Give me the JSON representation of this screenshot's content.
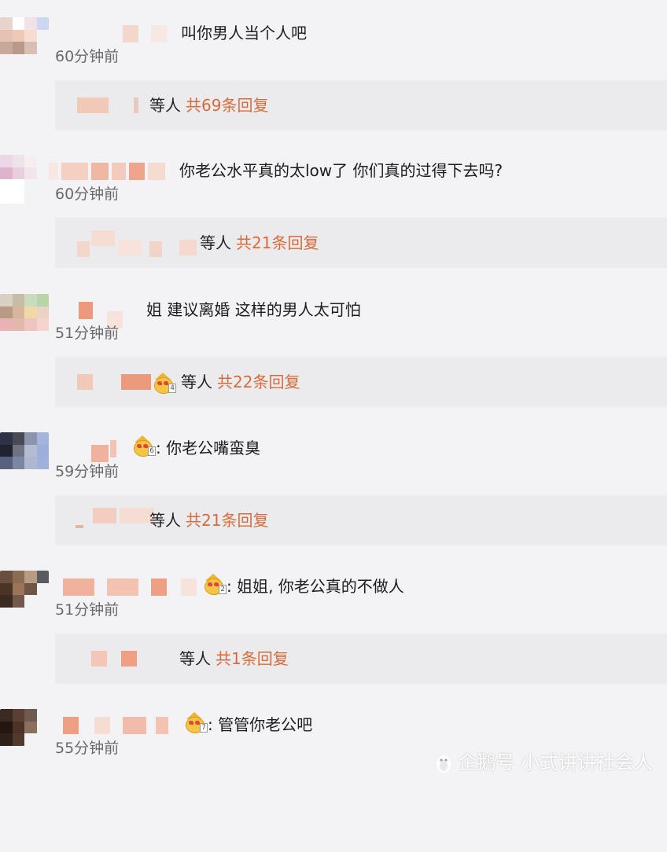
{
  "colors": {
    "background": "#f3f3f5",
    "reply_box": "#ebebed",
    "reply_count": "#d96b3b",
    "time_text": "#6a6a6a"
  },
  "comments": [
    {
      "text": "叫你男人当个人吧",
      "time": "60分钟前",
      "reply_prefix": "等人",
      "reply_count": "共69条回复",
      "badge_level": ""
    },
    {
      "text": "你老公水平真的太low了 你们真的过得下去吗?",
      "time": "60分钟前",
      "reply_prefix": "等人",
      "reply_count": "共21条回复",
      "badge_level": ""
    },
    {
      "text": "姐 建议离婚 这样的男人太可怕",
      "time": "51分钟前",
      "reply_prefix": "等人",
      "reply_count": "共22条回复",
      "badge_level": "4"
    },
    {
      "text": ": 你老公嘴蛮臭",
      "time": "59分钟前",
      "reply_prefix": "等人",
      "reply_count": "共21条回复",
      "badge_level": "6"
    },
    {
      "text": ": 姐姐, 你老公真的不做人",
      "time": "51分钟前",
      "reply_prefix": "等人",
      "reply_count": "共1条回复",
      "badge_level": "2"
    },
    {
      "text": ": 管管你老公吧",
      "time": "55分钟前",
      "reply_prefix": "",
      "reply_count": "",
      "badge_level": "7"
    }
  ],
  "watermark": {
    "icon": "penguin-icon",
    "text": "企鹅号 小式讲讲社会人"
  }
}
